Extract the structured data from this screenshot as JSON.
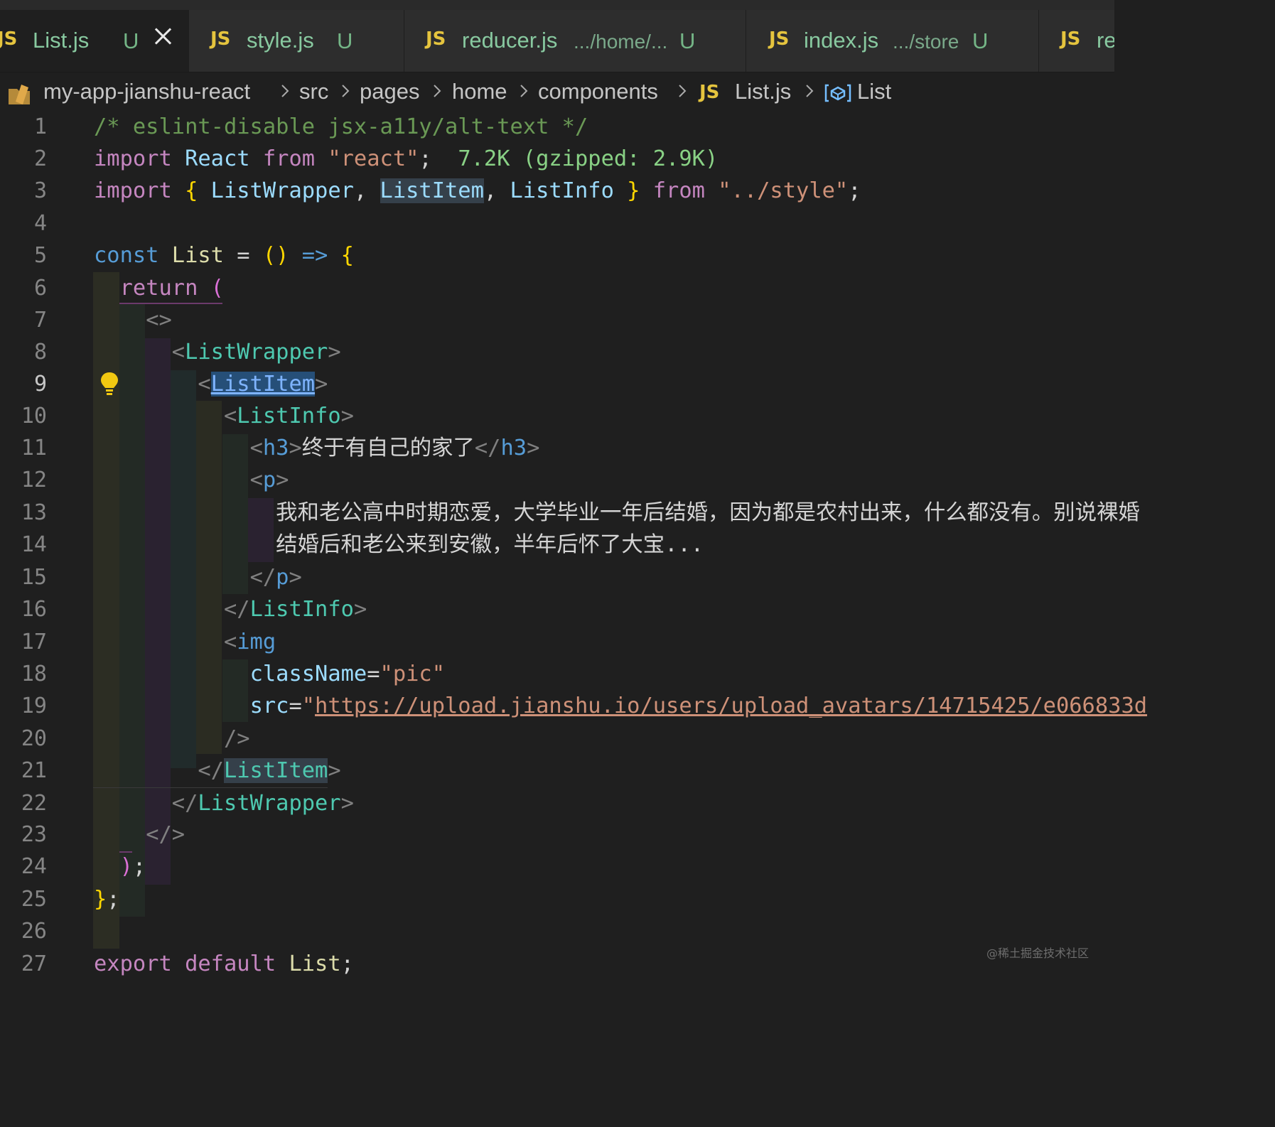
{
  "tabs": [
    {
      "js": "JS",
      "name": "List.js",
      "badge": "U",
      "path": ""
    },
    {
      "js": "JS",
      "name": "style.js",
      "badge": "U",
      "path": ""
    },
    {
      "js": "JS",
      "name": "reducer.js",
      "badge": "U",
      "path": ".../home/..."
    },
    {
      "js": "JS",
      "name": "index.js",
      "badge": "U",
      "path": ".../store"
    },
    {
      "js": "JS",
      "name": "re",
      "badge": "",
      "path": ""
    }
  ],
  "breadcrumb": {
    "items": [
      "my-app-jianshu-react",
      "src",
      "pages",
      "home",
      "components"
    ],
    "file_js": "JS",
    "file": "List.js",
    "symbol": "List"
  },
  "editor": {
    "current_line": 9,
    "line_numbers": [
      "1",
      "2",
      "3",
      "4",
      "5",
      "6",
      "7",
      "8",
      "9",
      "10",
      "11",
      "12",
      "13",
      "14",
      "15",
      "16",
      "17",
      "18",
      "19",
      "20",
      "21",
      "22",
      "23",
      "24",
      "25",
      "26",
      "27"
    ],
    "code": {
      "l1": "/* eslint-disable jsx-a11y/alt-text */",
      "l2_import": "import",
      "l2_react": "React",
      "l2_from": "from",
      "l2_str": "\"react\"",
      "l2_semi": ";",
      "l2_hint": "7.2K (gzipped: 2.9K)",
      "l3_import": "import",
      "l3_ob": "{",
      "l3_a": "ListWrapper",
      "l3_c1": ",",
      "l3_b": "ListItem",
      "l3_c2": ",",
      "l3_c": "ListInfo",
      "l3_cb": "}",
      "l3_from": "from",
      "l3_str": "\"../style\"",
      "l3_semi": ";",
      "l5_const": "const",
      "l5_name": "List",
      "l5_eq": "=",
      "l5_parens": "()",
      "l5_arrow": "=>",
      "l5_brace": "{",
      "l6_return": "return",
      "l6_paren": "(",
      "l7": "<>",
      "l8_open": "<",
      "l8_tag": "ListWrapper",
      "l8_close": ">",
      "l9_open": "<",
      "l9_tag": "ListItem",
      "l9_close": ">",
      "l10_open": "<",
      "l10_tag": "ListInfo",
      "l10_close": ">",
      "l11_open": "<",
      "l11_tag": "h3",
      "l11_close": ">",
      "l11_text": "终于有自己的家了",
      "l11_endopen": "</",
      "l11_endtag": "h3",
      "l11_endclose": ">",
      "l12_open": "<",
      "l12_tag": "p",
      "l12_close": ">",
      "l13": "我和老公高中时期恋爱，大学毕业一年后结婚，因为都是农村出来，什么都没有。别说裸婚",
      "l14": "结婚后和老公来到安徽，半年后怀了大宝...",
      "l15_open": "</",
      "l15_tag": "p",
      "l15_close": ">",
      "l16_open": "</",
      "l16_tag": "ListInfo",
      "l16_close": ">",
      "l17_open": "<",
      "l17_tag": "img",
      "l18_attr": "className",
      "l18_eq": "=",
      "l18_val": "\"pic\"",
      "l19_attr": "src",
      "l19_eq": "=",
      "l19_q": "\"",
      "l19_url": "https://upload.jianshu.io/users/upload_avatars/14715425/e066833d",
      "l20": "/>",
      "l21_open": "</",
      "l21_tag": "ListItem",
      "l21_close": ">",
      "l22_open": "</",
      "l22_tag": "ListWrapper",
      "l22_close": ">",
      "l23": "</>",
      "l24_paren": ")",
      "l24_semi": ";",
      "l25_brace": "}",
      "l25_semi": ";",
      "l27_export": "export",
      "l27_default": "default",
      "l27_name": "List",
      "l27_semi": ";"
    }
  },
  "watermark": "@稀土掘金技术社区",
  "colors": {
    "background": "#1f1f1f",
    "js_badge": "#e5c43e",
    "tab_name": "#88c9a0",
    "tag": "#4ec9b0",
    "keyword": "#c586c0",
    "string": "#ce9178",
    "comment": "#6a9955"
  },
  "icons": [
    "close-icon",
    "folder-icon",
    "chevron-right-icon",
    "symbol-variable-icon",
    "lightbulb-icon"
  ]
}
